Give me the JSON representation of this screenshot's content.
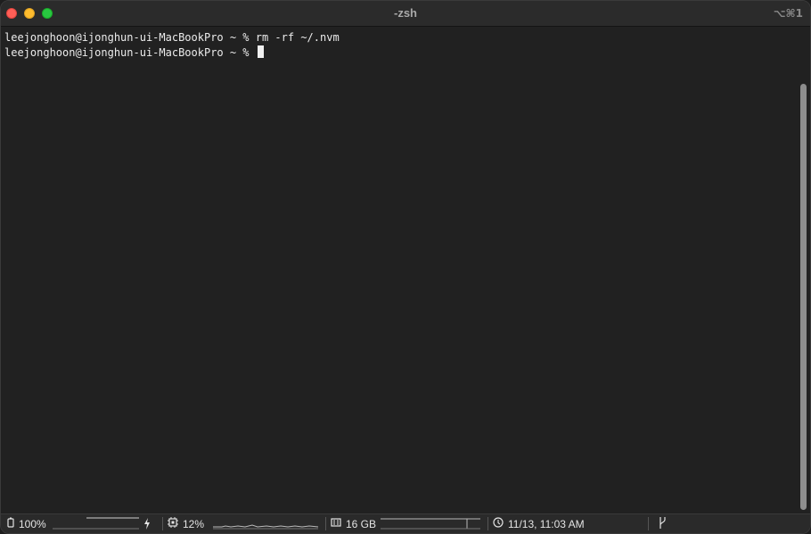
{
  "window": {
    "title": "-zsh",
    "shortcut": "⌥⌘1"
  },
  "terminal": {
    "lines": [
      "leejonghoon@ijonghun-ui-MacBookPro ~ % rm -rf ~/.nvm",
      "leejonghoon@ijonghun-ui-MacBookPro ~ % "
    ]
  },
  "statusbar": {
    "battery": {
      "icon": "battery-icon",
      "value": "100%"
    },
    "cpu": {
      "icon": "cpu-icon",
      "value": "12%"
    },
    "memory": {
      "icon": "memory-icon",
      "value": "16 GB"
    },
    "clock": {
      "icon": "clock-icon",
      "value": "11/13, 11:03 AM"
    },
    "git": {
      "icon": "git-branch-icon"
    }
  },
  "colors": {
    "background": "#212121",
    "titlebar": "#2b2b2b",
    "text": "#ececec",
    "close": "#ff5f57",
    "minimize": "#febc2e",
    "maximize": "#28c840"
  }
}
